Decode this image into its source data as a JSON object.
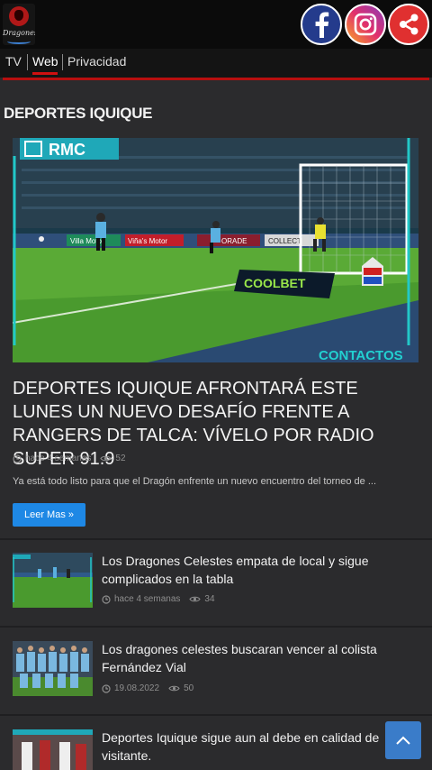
{
  "header": {
    "logo_text": "Dragones",
    "social": [
      {
        "name": "facebook",
        "icon": "facebook-icon"
      },
      {
        "name": "instagram",
        "icon": "instagram-icon"
      },
      {
        "name": "share",
        "icon": "share-icon"
      }
    ]
  },
  "nav": {
    "items": [
      "TV",
      "Web",
      "Privacidad"
    ],
    "active": "Web"
  },
  "section": {
    "title": "DEPORTES IQUIQUE"
  },
  "featured": {
    "image_text": {
      "top_logo": "RMC",
      "bottom_label": "CONTACTOS",
      "sponsor": "COOLBET",
      "ad1": "Villa Motor",
      "ad2": "Viña's Motor",
      "ad3": "ORADE",
      "ad4": "COLLECT"
    },
    "title": "DEPORTES IQUIQUE AFRONTARÁ ESTE LUNES UN NUEVO DESAFÍO FRENTE A RANGERS DE TALCA: VÍVELO POR RADIO SUPER 91.9",
    "date": "hace 4 semanas",
    "views": "52",
    "excerpt": "Ya está todo listo para que el Dragón enfrente un nuevo encuentro del torneo de ...",
    "read_more": "Leer Mas »"
  },
  "articles": [
    {
      "title": "Los Dragones Celestes empata de local y sigue complicados en la tabla",
      "date": "hace 4 semanas",
      "views": "34"
    },
    {
      "title": "Los dragones celestes buscaran vencer al colista Fernández Vial",
      "date": "19.08.2022",
      "views": "50"
    },
    {
      "title": "Deportes Iquique sigue aun al debe en calidad de visitante.",
      "date": "",
      "views": ""
    }
  ],
  "colors": {
    "accent_red": "#b80f0f",
    "button_blue": "#1e88e5",
    "scroll_blue": "#3a7cc9",
    "background": "#2b2b2d"
  }
}
